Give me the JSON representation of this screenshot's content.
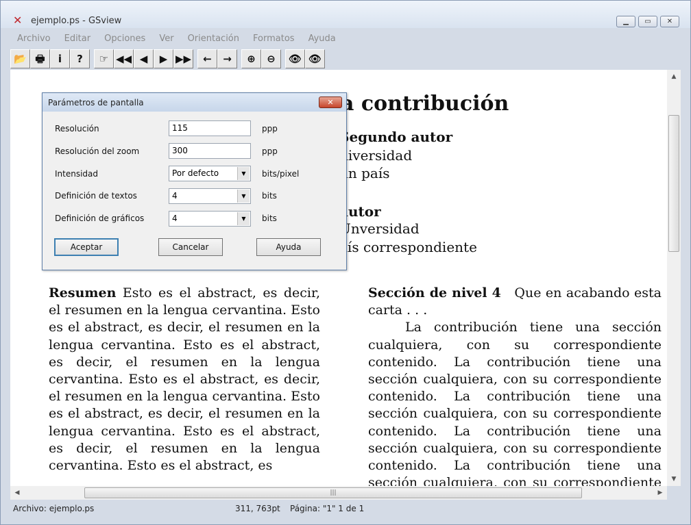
{
  "window": {
    "title": "ejemplo.ps - GSview"
  },
  "menu": [
    "Archivo",
    "Editar",
    "Opciones",
    "Ver",
    "Orientación",
    "Formatos",
    "Ayuda"
  ],
  "toolbar": {
    "groups": [
      [
        "open-icon",
        "print-icon",
        "info-icon",
        "help-icon"
      ],
      [
        "goto-page-icon",
        "first-page-icon",
        "prev-page-icon",
        "next-page-icon",
        "last-page-icon"
      ],
      [
        "back-icon",
        "forward-icon"
      ],
      [
        "zoom-in-icon",
        "zoom-out-icon"
      ],
      [
        "text-search-icon",
        "text-search-next-icon"
      ]
    ],
    "glyphs": {
      "open-icon": "📂",
      "print-icon": "🖶",
      "info-icon": "i",
      "help-icon": "?",
      "goto-page-icon": "☞",
      "first-page-icon": "◀◀",
      "prev-page-icon": "◀",
      "next-page-icon": "▶",
      "last-page-icon": "▶▶",
      "back-icon": "←",
      "forward-icon": "→",
      "zoom-in-icon": "⊕",
      "zoom-out-icon": "⊖",
      "text-search-icon": "👁",
      "text-search-next-icon": "👁"
    }
  },
  "document": {
    "title_fragment": "a contribución",
    "author2": {
      "name": "Segundo autor",
      "org": "niversidad",
      "country": "ún país"
    },
    "author3": {
      "name": "autor",
      "org": "Unversidad",
      "country": "aís correspondiente"
    },
    "abstract_heading": "Resumen",
    "abstract_text": "Esto es el abstract, es decir, el resumen en la lengua cervantina. Esto es el abstract, es decir, el resumen en la lengua cervantina. Esto es el abstract, es decir, el resumen en la lengua cervantina. Esto es el abstract, es decir, el resumen en la lengua cervantina. Esto es el abstract, es decir, el resumen en la lengua cervantina. Esto es el abstract, es decir, el resumen en la lengua cervantina. Esto es el abstract, es",
    "section_heading": "Sección de nivel 4",
    "section_intro": "Que en acabando esta carta . . .",
    "section_text": "La contribución tiene una sección cualquiera, con su correspondiente contenido. La contribución tiene una sección cualquiera, con su correspondiente contenido. La contribución tiene una sección cualquiera, con su correspondiente contenido. La contribución tiene una sección cualquiera, con su correspondiente contenido. La contribución tiene una sección cualquiera, con su correspondiente contenido. La contribución tiene una sección"
  },
  "dialog": {
    "title": "Parámetros de pantalla",
    "fields": [
      {
        "label": "Resolución",
        "value": "115",
        "unit": "ppp",
        "kind": "input"
      },
      {
        "label": "Resolución del zoom",
        "value": "300",
        "unit": "ppp",
        "kind": "input"
      },
      {
        "label": "Intensidad",
        "value": "Por defecto",
        "unit": "bits/pixel",
        "kind": "select"
      },
      {
        "label": "Definición de textos",
        "value": "4",
        "unit": "bits",
        "kind": "select"
      },
      {
        "label": "Definición de gráficos",
        "value": "4",
        "unit": "bits",
        "kind": "select"
      }
    ],
    "buttons": {
      "ok": "Aceptar",
      "cancel": "Cancelar",
      "help": "Ayuda"
    }
  },
  "status": {
    "file": "Archivo: ejemplo.ps",
    "coords": "311, 763pt",
    "page": "Página: \"1\"  1 de 1"
  }
}
